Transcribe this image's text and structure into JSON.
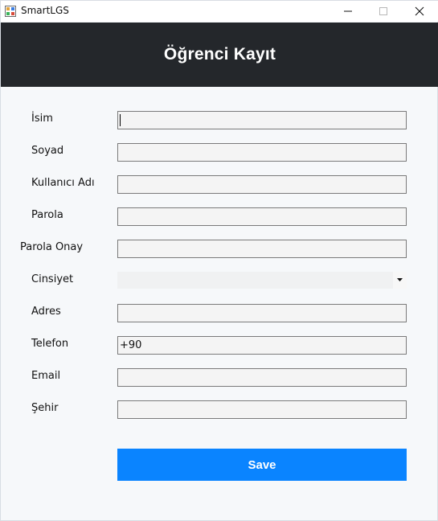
{
  "window": {
    "title": "SmartLGS"
  },
  "header": {
    "title": "Öğrenci Kayıt"
  },
  "form": {
    "fields": [
      {
        "label": "İsim",
        "value": ""
      },
      {
        "label": "Soyad",
        "value": ""
      },
      {
        "label": "Kullanıcı Adı",
        "value": ""
      },
      {
        "label": "Parola",
        "value": ""
      },
      {
        "label": "Parola Onay",
        "value": ""
      },
      {
        "label": "Cinsiyet",
        "value": ""
      },
      {
        "label": "Adres",
        "value": ""
      },
      {
        "label": "Telefon",
        "value": "+90"
      },
      {
        "label": "Email",
        "value": ""
      },
      {
        "label": "Şehir",
        "value": ""
      }
    ],
    "save_label": "Save"
  },
  "colors": {
    "header_bg": "#24272b",
    "save_button_bg": "#0a84ff",
    "form_bg": "#f6f8fa"
  },
  "icons": {
    "app": "app-icon",
    "minimize": "minimize-icon",
    "maximize": "maximize-icon",
    "close": "close-icon",
    "dropdown": "chevron-down-icon"
  }
}
